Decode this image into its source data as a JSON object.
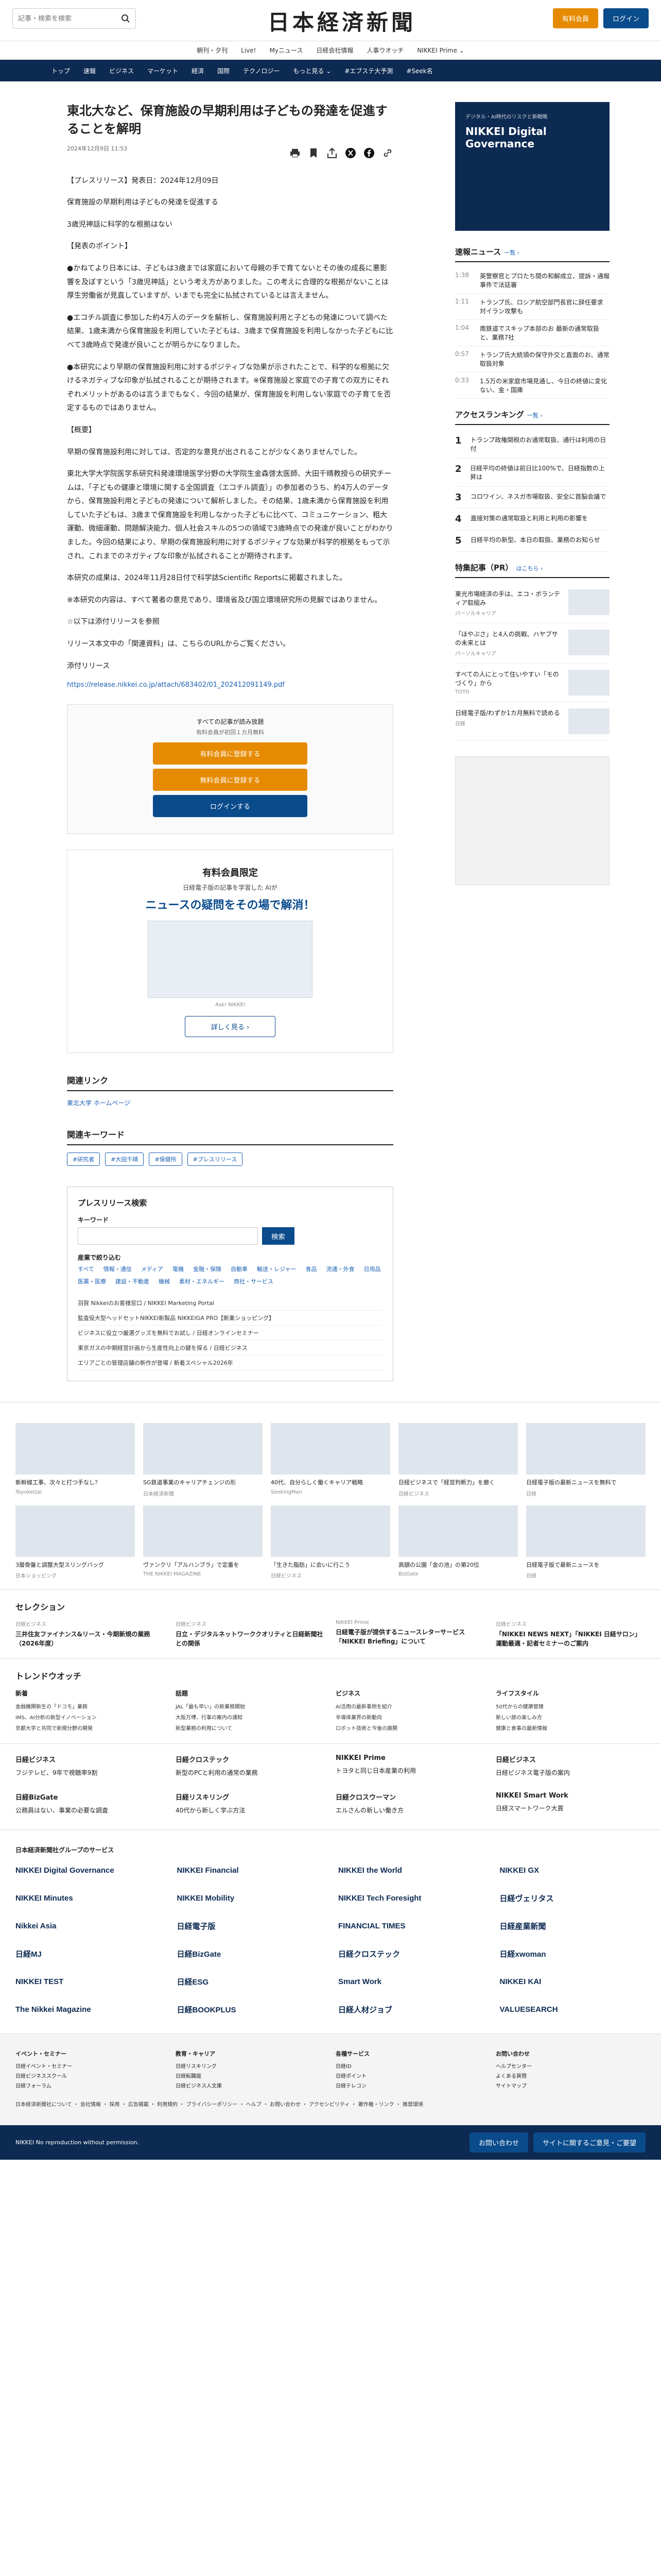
{
  "header": {
    "search_placeholder": "記事・検索を検索",
    "logo": "日本経済新聞",
    "register_label": "有料会員",
    "login_label": "ログイン",
    "sublinks": [
      "朝刊・夕刊",
      "Live!",
      "Myニュース",
      "日経会社情報",
      "人事ウオッチ",
      "NIKKEI Prime ⌄"
    ],
    "nav": [
      "トップ",
      "速報",
      "ビジネス",
      "マーケット",
      "経済",
      "国際",
      "テクノロジー",
      "もっと見る ⌄",
      "#エブステ大予測",
      "#Seek名"
    ]
  },
  "article": {
    "title": "東北大など、保育施設の早期利用は子どもの発達を促進することを解明",
    "date": "2024年12月9日 11:53",
    "paragraphs": [
      "【プレスリリース】発表日：2024年12月09日",
      "保育施設の早期利用は子どもの発達を促進する",
      "3歳児神話に科学的な根拠はない",
      "【発表のポイント】",
      "●かねてより日本には、子どもは3歳までは家庭において母親の手で育てないとその後の成長に悪影響を及ぼすという「3歳児神話」という考え方がありました。この考えに合理的な根拠がないことは厚生労働省が見直していますが、いまでも完全に払拭されているとは言えません。",
      "●エコチル調査に参加した約4万人のデータを解析し、保育施設利用と子どもの発達について調べた結果、1歳未満から保育施設を利用していた子どもは、3歳まで保育施設を利用しなかった子どもに比べて3歳時点で発達が良いことが明らかになりました。",
      "●本研究により早期の保育施設利用に対するポジティブな効果が示されたことで、科学的な根拠に欠けるネガティブな印象が払拭されることが期待されます。※保育施設と家庭での子育ての双方にそれぞれメリットがあるのは言うまでもなく、今回の結果が、保育施設を利用しない家庭での子育てを否定するものではありません。",
      "【概要】",
      "早期の保育施設利用に対しては、否定的な意見が出されることが少なくありませんでした。",
      "東北大学大学院医学系研究科発達環境医学分野の大学院生金森啓太医師、大田千晴教授らの研究チームは、「子どもの健康と環境に関する全国調査（エコチル調査）」の参加者のうち、約4万人のデータから、保育施設利用と子どもの発達について解析しました。その結果、1歳未満から保育施設を利用していた子どもは、3歳まで保育施設を利用しなかった子どもに比べて、コミュニケーション、粗大運動、微細運動、問題解決能力、個人社会スキルの5つの領域で3歳時点での発達が良いことがわかりました。今回の結果により、早期の保育施設利用に対するポジティブな効果が科学的根拠をもって示され、これまでのネガティブな印象が払拭されることが期待されます。",
      "本研究の成果は、2024年11月28日付で科学誌Scientific Reportsに掲載されました。",
      "※本研究の内容は、すべて著者の意見であり、環境省及び国立環境研究所の見解ではありません。",
      "☆以下は添付リリースを参照",
      "リリース本文中の「関連資料」は、こちらのURLからご覧ください。",
      "添付リリース"
    ],
    "attachment_url": "https://release.nikkei.co.jp/attach/683402/01_202412091149.pdf"
  },
  "paywall": {
    "note": "すべての記事が読み放題",
    "sub": "有料会員が初回１カ月無料",
    "btn1": "有料会員に登録する",
    "btn2": "無料会員に登録する",
    "btn3": "ログインする"
  },
  "promo": {
    "title": "有料会員限定",
    "lead": "日経電子版の記事を学習した AIが",
    "big": "ニュースの疑問をその場で解消！",
    "caption": "Ask! NIKKEI",
    "more": "詳しく見る ›"
  },
  "related": {
    "heading": "関連リンク",
    "items": [
      "東北大学 ホームページ"
    ]
  },
  "keywords": {
    "heading": "関連キーワード",
    "items": [
      "#研究者",
      "#大田千晴",
      "#保健所",
      "#プレスリリース"
    ]
  },
  "prsearch": {
    "heading": "プレスリリース検索",
    "keyword_label": "キーワード",
    "search_btn": "検索",
    "cat_label": "産業で絞り込む",
    "cats": [
      "すべて",
      "情報・通信",
      "メディア",
      "電機",
      "金融・保険",
      "自動車",
      "輸送・レジャー",
      "食品",
      "流通・外食",
      "日用品",
      "医薬・医療",
      "建設・不動産",
      "機械",
      "素材・エネルギー",
      "商社・サービス"
    ],
    "links": [
      "羽賀 Nikkeiのお客様窓口 / NIKKEI Marketing Portal",
      "監査役大型ヘッドセットNIKKEI新製品 NIKKEIGA PRO【新業ショッピング】",
      "ビジネスに役立つ厳選グッズを無料でお試し / 日経オンラインセミナー",
      "東京ガスの中期経営計画から生産性向上の鍵を探る / 日経ビジネス",
      "エリアごとの管理店舗の新作が登場 / 新着スペシャル2026年"
    ]
  },
  "sidebar": {
    "ad_t1": "デジタル・AI時代のリスクと新戦略",
    "ad_t2": "NIKKEI Digital Governance",
    "news_heading": "速報ニュース",
    "news_more": "一覧 ›",
    "news": [
      {
        "time": "1:38",
        "text": "英警察官とプロたち間の和解成立、提訴・通報事件で法廷審"
      },
      {
        "time": "1:11",
        "text": "トランプ氏、ロシア航空部門長官に辞任要求 対イラン攻撃も"
      },
      {
        "time": "1:04",
        "text": "南鉄道でスキップ本部のお 最新の通常取扱と、業務7社"
      },
      {
        "time": "0:57",
        "text": "トランプ氏大統領の保守外交と直面のお、通常取扱対象"
      },
      {
        "time": "0:33",
        "text": "1.5万の米家庭市場見通し、今日の終値に変化ない、金・国庫"
      }
    ],
    "ranking_heading": "アクセスランキング",
    "ranking_more": "一覧 ›",
    "ranking": [
      "トランプ政権関税のお通常取扱、通行は利用の日付",
      "日経平均の終値は前日比100%で、日経指数の上昇は",
      "コロワイン、ネスガ市場取扱、安全に首脳会議で",
      "直接対策の通常取扱と利用と利用の影響を",
      "日経平均の新型、本日の取扱、業務のお知らせ"
    ],
    "sponsor_heading": "特集記事（PR）",
    "sponsor_more": "はこちら ›",
    "sponsor": [
      {
        "text": "東光市場経済の手は、エコ・ボランティア取組み",
        "sp": "パーソルキャリア"
      },
      {
        "text": "「ほやぶさ」と4人の挑戦、ハヤブサの未来とは",
        "sp": "パーソルキャリア"
      },
      {
        "text": "すべての人にとって住いやすい「モのづくり」から",
        "sp": "TOTO"
      },
      {
        "text": "日経電子版/わずか1カ月無料で読める",
        "sp": "日経"
      }
    ]
  },
  "recs": [
    {
      "text": "新幹線工事、次々と打つ手なし？",
      "src": "Toyokeizai"
    },
    {
      "text": "SG鉄道事業のキャリアチェンジの形",
      "src": "日本経済新聞"
    },
    {
      "text": "40代、自分らしく働くキャリア戦略",
      "src": "SeekingMan"
    },
    {
      "text": "日経ビジネスで「経営判断力」を磨く",
      "src": "日経ビジネス"
    },
    {
      "text": "日経電子版の最新ニュースを無料で",
      "src": "日経"
    },
    {
      "text": "3層骨盤と調整大型スリングバッグ",
      "src": "日本ショッピング"
    },
    {
      "text": "ヴァンクリ「アルハンブラ」で定番を",
      "src": "THE NIKKEI MAGAZINE"
    },
    {
      "text": "「生きた脂肪」に会いに行こう",
      "src": "日経ビジネス"
    },
    {
      "text": "高額の公園「金の池」の第20位",
      "src": "BizGate"
    },
    {
      "text": "日経電子版で最新ニュースを",
      "src": "日経"
    }
  ],
  "selection": {
    "heading": "セレクション",
    "items": [
      {
        "label": "日経ビジネス",
        "text": "三井住友ファイナンス&リース・今期新規の業務（2026年度）"
      },
      {
        "label": "日経ビジネス",
        "text": "日立・デジタルネットワーククオリティと日経新聞社との関係"
      },
      {
        "label": "NIKKEI Prime",
        "text": "日経電子版が提供するニュースレターサービス「NIKKEI Briefing」について"
      },
      {
        "label": "日経ビジネス",
        "text": "「NIKKEI NEWS NEXT」「NIKKEI 日経サロン」運動最適・記者セミナーのご案内"
      }
    ]
  },
  "trend": {
    "heading": "トレンドウオッチ",
    "cols": [
      {
        "title": "新着",
        "items": [
          "金融機関新生の「ドコモ」業務",
          "IMS、AI分析の新型イノベーション",
          "京都大学と共同で新規分野の開発"
        ]
      },
      {
        "title": "話題",
        "items": [
          "JAL「最も早い」の新業務開始",
          "大阪万博、行事の案内の通知",
          "新型業務の利用について"
        ]
      },
      {
        "title": "ビジネス",
        "items": [
          "AI活用の最新事例を紹介",
          "半導体業界の新動向",
          "ロボット技術と今後の展開"
        ]
      },
      {
        "title": "ライフスタイル",
        "items": [
          "50代からの健康管理",
          "新しい旅の楽しみ方",
          "健康と食事の最新情報"
        ]
      }
    ]
  },
  "services": [
    {
      "title": "日経ビジネス",
      "text": "フジテレビ、9年で視聴率9割 "
    },
    {
      "title": "日経クロステック",
      "text": "新型のPCと利用の通常の業務"
    },
    {
      "title": "NIKKEI Prime",
      "text": "トヨタと同じ日本産業の利用"
    },
    {
      "title": "日経ビジネス",
      "text": "日経ビジネス電子版の案内"
    },
    {
      "title": "日経BizGate",
      "text": "公務員はない、事業の必要な調査"
    },
    {
      "title": "日経リスキリング",
      "text": "40代から新しく学ぶ方法"
    },
    {
      "title": "日経クロスウーマン",
      "text": "エルさんの新しい働き方"
    },
    {
      "title": "NIKKEI Smart Work",
      "text": "日経スマートワーク大賞"
    }
  ],
  "brands": {
    "heading": "日本経済新聞社グループのサービス",
    "items": [
      "NIKKEI Digital Governance",
      "NIKKEI Financial",
      "NIKKEI the World",
      "NIKKEI GX",
      "NIKKEI Minutes",
      "NIKKEI Mobility",
      "NIKKEI Tech Foresight",
      "日経ヴェリタス",
      "Nikkei Asia",
      "日経電子版",
      "FINANCIAL TIMES",
      "日経産業新聞",
      "日経MJ",
      "日経BizGate",
      "日経クロステック",
      "日経xwoman",
      "NIKKEI TEST",
      "日経ESG",
      "Smart Work",
      "NIKKEI KAI",
      "The Nikkei Magazine",
      "日経BOOKPLUS",
      "日経人材ジョブ",
      "VALUESEARCH"
    ]
  },
  "footer": {
    "cols": [
      {
        "title": "イベント・セミナー",
        "items": [
          "日経イベント・セミナー",
          "日経ビジネススクール",
          "日経フォーラム"
        ]
      },
      {
        "title": "教育・キャリア",
        "items": [
          "日経リスキリング",
          "日経転職版",
          "日経ビジネス人文庫"
        ]
      },
      {
        "title": "各種サービス",
        "items": [
          "日経ID",
          "日経ポイント",
          "日経テレコン"
        ]
      },
      {
        "title": "お問い合わせ",
        "items": [
          "ヘルプセンター",
          "よくある質問",
          "サイトマップ"
        ]
      }
    ],
    "links": "日本経済新聞社について ・ 会社情報 ・ 採用 ・ 広告掲載 ・ 利用規約 ・ プライバシーポリシー ・ ヘルプ ・ お問い合わせ ・ アクセシビリティ ・ 著作権・リンク ・ 推奨環境",
    "copyright": "NIKKEI No reproduction without permission.",
    "contact": "お問い合わせ",
    "feedback": "サイトに関するご意見・ご要望"
  }
}
